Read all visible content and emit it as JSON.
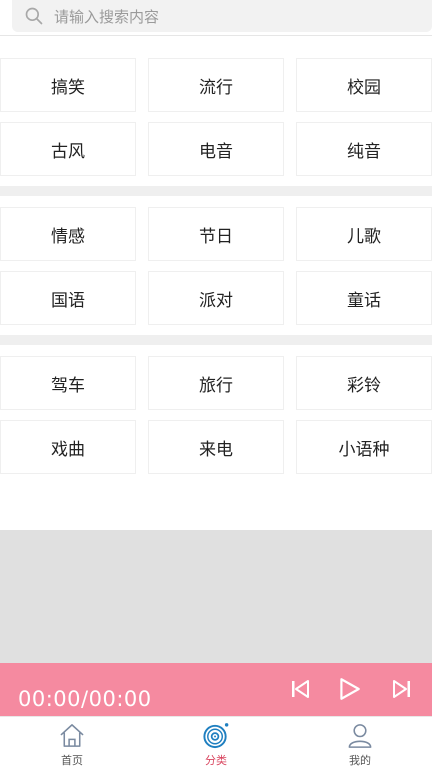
{
  "search": {
    "placeholder": "请输入搜索内容"
  },
  "groups": [
    {
      "rows": [
        [
          "搞笑",
          "流行",
          "校园"
        ],
        [
          "古风",
          "电音",
          "纯音"
        ]
      ]
    },
    {
      "rows": [
        [
          "情感",
          "节日",
          "儿歌"
        ],
        [
          "国语",
          "派对",
          "童话"
        ]
      ]
    },
    {
      "rows": [
        [
          "驾车",
          "旅行",
          "彩铃"
        ],
        [
          "戏曲",
          "来电",
          "小语种"
        ]
      ]
    }
  ],
  "player": {
    "time": "00:00/00:00"
  },
  "tabbar": {
    "tabs": [
      {
        "label": "首页",
        "icon": "home-icon",
        "active": false
      },
      {
        "label": "分类",
        "icon": "category-disc-icon",
        "active": true
      },
      {
        "label": "我的",
        "icon": "profile-icon",
        "active": false
      }
    ]
  },
  "colors": {
    "accent": "#d9455f",
    "player_bg": "#f58aa0",
    "filler": "#e0e0e0"
  }
}
